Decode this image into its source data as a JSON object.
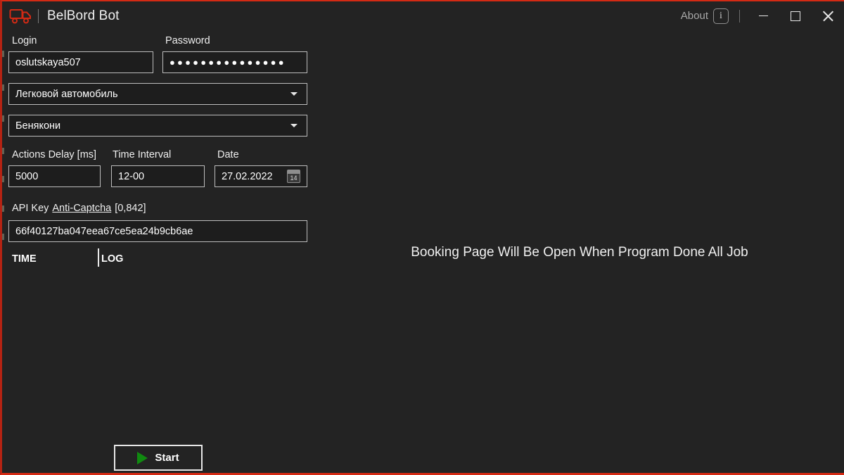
{
  "window": {
    "title": "BelBord Bot",
    "app_icon": "truck-icon",
    "accent_color": "#d42a14",
    "background_color": "#232323"
  },
  "titlebar": {
    "about_label": "About",
    "about_icon": "info-icon",
    "minimize_icon": "minimize-icon",
    "maximize_icon": "maximize-icon",
    "close_icon": "close-icon"
  },
  "form": {
    "login": {
      "label": "Login",
      "value": "oslutskaya507"
    },
    "password": {
      "label": "Password",
      "value": "●●●●●●●●●●●●●●●"
    },
    "vehicle_type": {
      "value": "Легковой автомобиль"
    },
    "checkpoint": {
      "value": "Бенякони"
    },
    "actions_delay": {
      "label": "Actions Delay [ms]",
      "value": "5000"
    },
    "time_interval": {
      "label": "Time Interval",
      "value": "12-00"
    },
    "date": {
      "label": "Date",
      "value": "27.02.2022",
      "calendar_icon_day": "14"
    },
    "api_key": {
      "label_prefix": "API Key",
      "link_text": "Anti-Captcha",
      "balance": "[0,842]",
      "value": "66f40127ba047eea67ce5ea24b9cb6ae"
    }
  },
  "log": {
    "time_header": "TIME",
    "log_header": "LOG",
    "rows": []
  },
  "actions": {
    "start_label": "Start",
    "start_icon": "play-icon",
    "start_icon_color": "#108a10"
  },
  "right_panel": {
    "message": "Booking Page Will Be Open When Program Done All Job"
  }
}
